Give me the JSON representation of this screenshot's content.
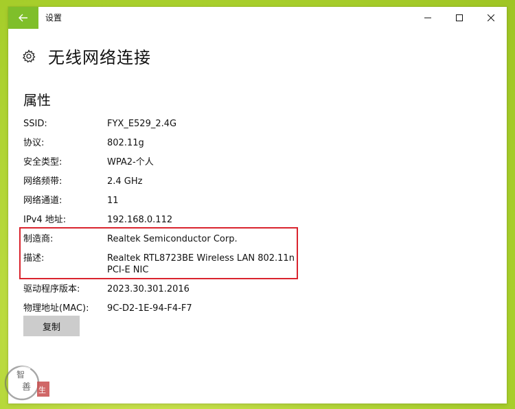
{
  "window": {
    "title": "设置"
  },
  "header": {
    "title": "无线网络连接"
  },
  "section": {
    "title": "属性"
  },
  "properties": [
    {
      "label": "SSID:",
      "value": "FYX_E529_2.4G"
    },
    {
      "label": "协议:",
      "value": "802.11g"
    },
    {
      "label": "安全类型:",
      "value": "WPA2-个人"
    },
    {
      "label": "网络频带:",
      "value": "2.4 GHz"
    },
    {
      "label": "网络通道:",
      "value": "11"
    },
    {
      "label": "IPv4 地址:",
      "value": "192.168.0.112"
    },
    {
      "label": "制造商:",
      "value": "Realtek Semiconductor Corp."
    },
    {
      "label": "描述:",
      "value": "Realtek RTL8723BE Wireless LAN 802.11n PCI-E NIC"
    },
    {
      "label": "驱动程序版本:",
      "value": "2023.30.301.2016"
    },
    {
      "label": "物理地址(MAC):",
      "value": "9C-D2-1E-94-F4-F7"
    }
  ],
  "copy_button": {
    "label": "复制"
  },
  "colors": {
    "accent": "#7fbf2a",
    "highlight_border": "#d9232d",
    "button_bg": "#cccccc"
  },
  "icons": {
    "back": "back-arrow-icon",
    "gear": "gear-icon",
    "minimize": "minimize-icon",
    "maximize": "maximize-icon",
    "close": "close-icon"
  },
  "watermark": {
    "chars": [
      "智",
      "善",
      "生"
    ]
  }
}
